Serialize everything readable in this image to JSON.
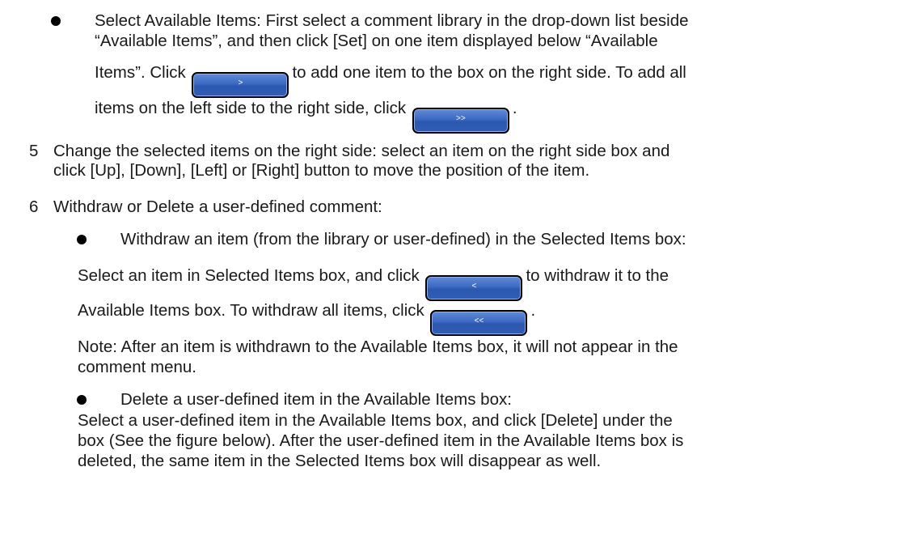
{
  "section4": {
    "line1": "Select Available Items: First select a comment library in the drop-down list beside",
    "line2": "“Available Items”, and then click [Set] on one item displayed below “Available",
    "line3a": "Items”. Click",
    "line3b": "to add one item to the box on the right side. To add all",
    "line4a": "items on the left side to the right side, click",
    "line4b": "."
  },
  "buttons": {
    "add_one": ">",
    "add_all": ">>",
    "withdraw_one": "<",
    "withdraw_all": "<<"
  },
  "step5": {
    "number": "5",
    "line1": "Change the selected items on the right side: select an item on the right side box and",
    "line2": "click [Up], [Down], [Left] or [Right] button to move the position of the item."
  },
  "step6": {
    "number": "6",
    "line1": "Withdraw or Delete a user-defined comment:",
    "bullet1": "Withdraw an item (from the library or user-defined) in the Selected Items box:",
    "w1a": "Select an item in Selected Items box, and click",
    "w1b": "to withdraw it to the",
    "w2a": "Available Items box. To withdraw all items, click",
    "w2b": ".",
    "note1": "Note: After an item is withdrawn to the Available Items box, it will not appear in the",
    "note2": "comment menu.",
    "bullet2": "Delete a user-defined item in the Available Items box:",
    "d1": "Select a user-defined item in the Available Items box, and click [Delete] under the",
    "d2": "box (See the figure below). After the user-defined item in the Available Items box is",
    "d3": "deleted, the same item in the Selected Items box will disappear as well."
  }
}
